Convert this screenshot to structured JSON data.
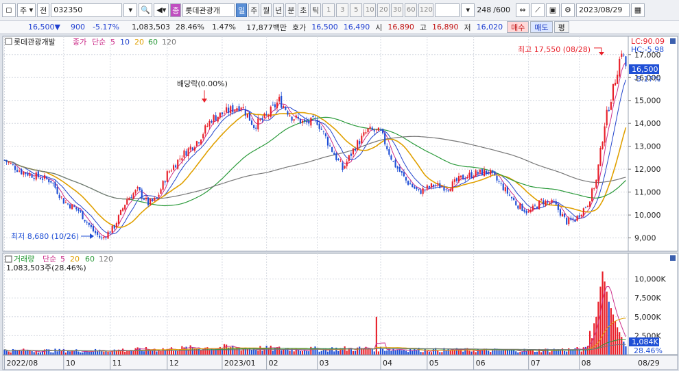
{
  "toolbar": {
    "period_label": "주",
    "market_label": "전",
    "code": "032350",
    "stock_name": "롯데관광개",
    "periods": [
      "일",
      "주",
      "월",
      "년",
      "분",
      "초",
      "틱"
    ],
    "active_period": "일",
    "counts": [
      "1",
      "3",
      "5",
      "10",
      "20",
      "30",
      "60",
      "120"
    ],
    "view_count": "248",
    "max_count": "/600",
    "date": "2023/08/29",
    "stock_badge": "종"
  },
  "quote": {
    "price": "16,500",
    "direction": "▼",
    "change": "900",
    "change_pct": "-5.17%",
    "volume": "1,083,503",
    "volume_ratio": "28.46%",
    "turnover": "1.47%",
    "amount": "17,877백만",
    "hoga_label": "호가",
    "ask": "16,500",
    "bid": "16,490",
    "open_label": "시",
    "open": "16,890",
    "high_label": "고",
    "high": "16,890",
    "low_label": "저",
    "low": "16,020",
    "buy_label": "매수",
    "sell_label": "매도",
    "eval_label": "평"
  },
  "colors": {
    "up": "#e8202a",
    "down": "#1f4fd6",
    "ma5": "#cc2e8a",
    "ma10": "#2244cc",
    "ma20": "#e0a000",
    "ma60": "#2a9a3a",
    "ma120": "#777777"
  },
  "chart_data": {
    "type": "candlestick",
    "legend": {
      "name": "롯데관광개발",
      "price_label": "종가",
      "ma_type": "단순",
      "periods": [
        "5",
        "10",
        "20",
        "60",
        "120"
      ]
    },
    "vol_legend": {
      "name": "거래량",
      "ma_type": "단순",
      "periods": [
        "5",
        "20",
        "60",
        "120"
      ],
      "value": "1,083,503주(28.46%)"
    },
    "y_ticks": [
      "17,000",
      "16,000",
      "15,000",
      "14,000",
      "13,000",
      "12,000",
      "11,000",
      "10,000",
      "9,000"
    ],
    "y_values": [
      17000,
      16000,
      15000,
      14000,
      13000,
      12000,
      11000,
      10000,
      9000
    ],
    "ylim": [
      8420,
      17800
    ],
    "vol_ticks": [
      "10,000K",
      "7,500K",
      "5,000K",
      "2,500K"
    ],
    "vol_values": [
      10000,
      7500,
      5000,
      2500
    ],
    "vol_lim": [
      0,
      12500
    ],
    "x_ticks": [
      "2022/08",
      "10",
      "11",
      "12",
      "2023/01",
      "02",
      "03",
      "04",
      "05",
      "06",
      "07",
      "08"
    ],
    "x_tick_index": [
      0,
      28,
      50,
      77,
      103,
      124,
      148,
      178,
      200,
      222,
      248,
      272
    ],
    "last_date": "08/29",
    "lc_label": "LC:90.09",
    "hc_label": "HC:-5.98",
    "current_price": "16,500",
    "current_pct": "-5.17%",
    "last_volume": "1,084K",
    "last_volume_pct": "28.46%",
    "annot_high": "최고 17,550 (08/28)",
    "annot_low": "최저 8,680 (10/26)",
    "annot_dividend": "배당락(0.00%)",
    "n_bars": 295,
    "anchors": [
      [
        0,
        12400
      ],
      [
        8,
        11900
      ],
      [
        15,
        11700
      ],
      [
        22,
        11500
      ],
      [
        28,
        10600
      ],
      [
        35,
        10200
      ],
      [
        42,
        9300
      ],
      [
        46,
        8950
      ],
      [
        52,
        9500
      ],
      [
        58,
        10700
      ],
      [
        63,
        11100
      ],
      [
        68,
        10500
      ],
      [
        72,
        10700
      ],
      [
        77,
        11800
      ],
      [
        84,
        12600
      ],
      [
        92,
        13300
      ],
      [
        98,
        14200
      ],
      [
        105,
        14500
      ],
      [
        112,
        14800
      ],
      [
        118,
        13900
      ],
      [
        124,
        14300
      ],
      [
        130,
        15000
      ],
      [
        136,
        14300
      ],
      [
        142,
        14000
      ],
      [
        148,
        14100
      ],
      [
        154,
        13000
      ],
      [
        160,
        12000
      ],
      [
        166,
        13000
      ],
      [
        172,
        13700
      ],
      [
        178,
        13600
      ],
      [
        184,
        12300
      ],
      [
        190,
        11500
      ],
      [
        196,
        11000
      ],
      [
        203,
        11300
      ],
      [
        210,
        11200
      ],
      [
        216,
        11600
      ],
      [
        222,
        11800
      ],
      [
        229,
        11900
      ],
      [
        236,
        11200
      ],
      [
        242,
        10500
      ],
      [
        248,
        10100
      ],
      [
        254,
        10600
      ],
      [
        260,
        10500
      ],
      [
        266,
        9700
      ],
      [
        270,
        9800
      ],
      [
        276,
        10500
      ],
      [
        280,
        11500
      ],
      [
        284,
        14000
      ],
      [
        288,
        15500
      ],
      [
        292,
        17200
      ],
      [
        294,
        16500
      ]
    ],
    "volume_anchors": [
      [
        0,
        0.55
      ],
      [
        40,
        0.5
      ],
      [
        80,
        0.75
      ],
      [
        100,
        0.95
      ],
      [
        140,
        0.7
      ],
      [
        175,
        0.8
      ],
      [
        200,
        0.6
      ],
      [
        250,
        0.55
      ],
      [
        275,
        0.7
      ],
      [
        280,
        5.0
      ],
      [
        283,
        11.0
      ],
      [
        286,
        7.0
      ],
      [
        290,
        3.6
      ],
      [
        294,
        1.084
      ]
    ]
  }
}
